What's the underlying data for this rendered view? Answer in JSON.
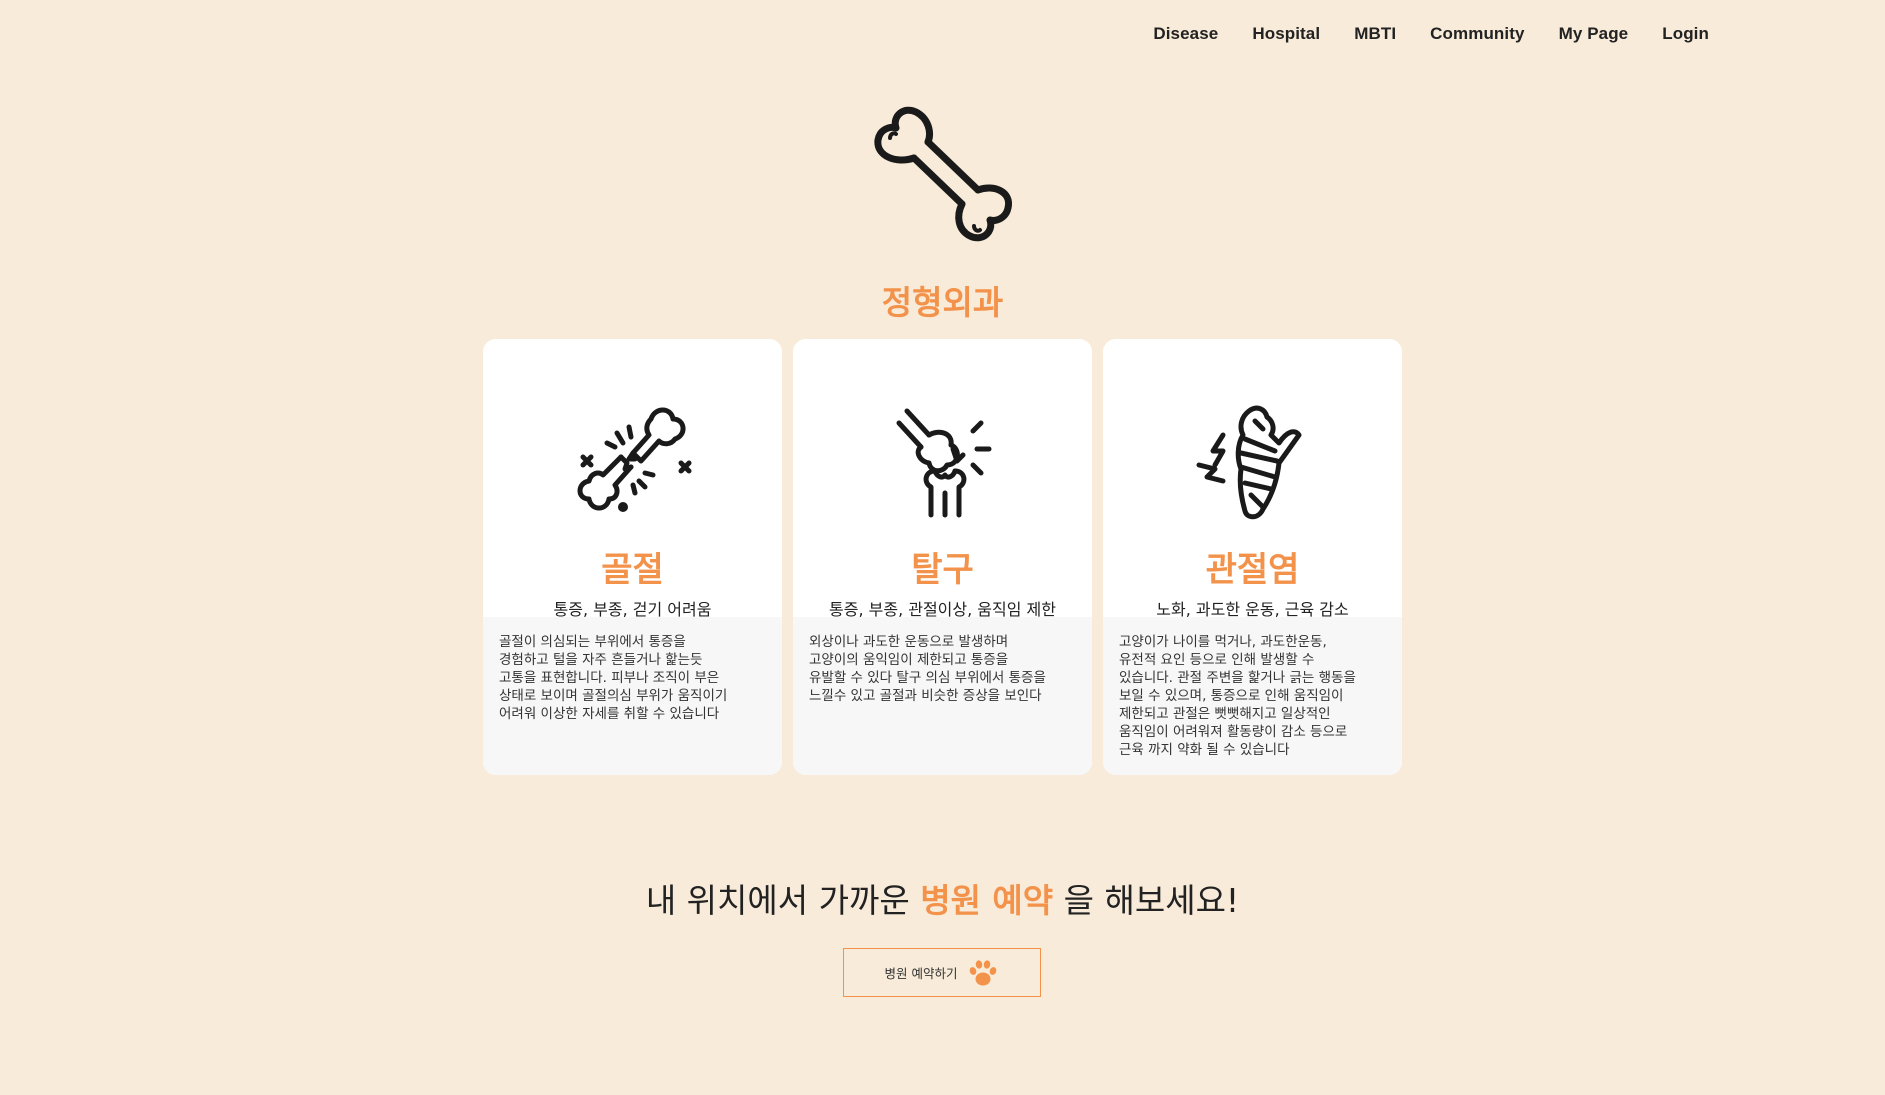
{
  "nav": {
    "items": [
      "Disease",
      "Hospital",
      "MBTI",
      "Community",
      "My Page",
      "Login"
    ]
  },
  "hero": {
    "icon": "bone-icon",
    "title": "정형외과"
  },
  "cards": [
    {
      "icon": "fracture-icon",
      "name": "골절",
      "symptoms": "통증, 부종, 걷기 어려움",
      "description": "골절이 의심되는 부위에서 통증을\n경험하고 털을 자주 흔들거나 핥는듯\n고통을 표현합니다. 피부나 조직이 부은\n상태로 보이며 골절의심 부위가 움직이기\n어려워 이상한 자세를 취할 수 있습니다"
    },
    {
      "icon": "dislocation-icon",
      "name": "탈구",
      "symptoms": "통증, 부종, 관절이상, 움직임 제한",
      "description": "외상이나 과도한 운동으로 발생하며\n고양이의 움익임이 제한되고 통증을\n유발할 수 있다 탈구 의심 부위에서 통증을\n느낄수 있고 골절과 비슷한 증상을 보인다"
    },
    {
      "icon": "arthritis-icon",
      "name": "관절염",
      "symptoms": "노화, 과도한 운동, 근육 감소",
      "description": "고양이가 나이를 먹거나, 과도한운동,\n유전적 요인 등으로 인해 발생할 수\n있습니다. 관절 주변을 핥거나 긁는 행동을\n보일 수 있으며, 통증으로 인해 움직임이\n제한되고 관절은 뻣뻣해지고 일상적인\n움직임이 어려워져 활동량이 감소 등으로\n근육 까지 약화 될 수 있습니다"
    }
  ],
  "cta": {
    "text_before": "내 위치에서 가까운",
    "text_highlight": "병원 예약",
    "text_after": "을 해보세요!",
    "button_label": "병원 예약하기",
    "button_icon": "paw-icon"
  },
  "colors": {
    "background": "#f8ebd9",
    "accent": "#f3924a",
    "card": "#ffffff",
    "card_desc": "#f7f7f7"
  }
}
